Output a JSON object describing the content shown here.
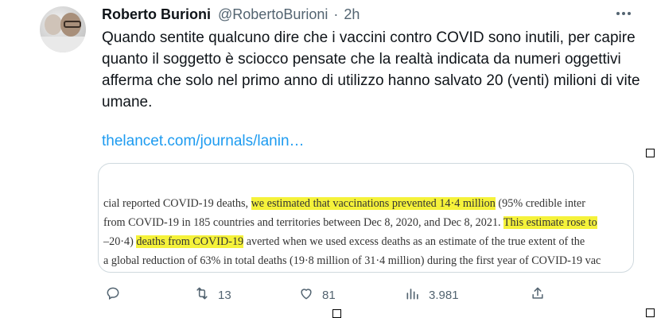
{
  "tweet": {
    "author_name": "Roberto Burioni",
    "handle": "@RobertoBurioni",
    "separator": "·",
    "time": "2h",
    "text": "Quando sentite qualcuno dire che i vaccini contro COVID sono inutili, per capire quanto il soggetto è sciocco pensate che la realtà indicata da numeri oggettivi afferma che solo nel primo anno di utilizzo hanno salvato 20 (venti) milioni di vite umane.",
    "link": "thelancet.com/journals/lanin…"
  },
  "media": {
    "lines": [
      [
        {
          "t": "cial reported COVID-19 deaths, ",
          "h": false
        },
        {
          "t": "we estimated that vaccinations prevented 14·4 million",
          "h": true
        },
        {
          "t": " (95% credible inter",
          "h": false
        }
      ],
      [
        {
          "t": "from COVID-19 in 185 countries and territories between Dec 8, 2020, and Dec 8, 2021. ",
          "h": false
        },
        {
          "t": "This estimate rose to",
          "h": true
        }
      ],
      [
        {
          "t": "–20·4) ",
          "h": false
        },
        {
          "t": "deaths from COVID-19",
          "h": true
        },
        {
          "t": " averted when we used excess deaths as an estimate of the true extent of the",
          "h": false
        }
      ],
      [
        {
          "t": "a global reduction of 63% in total deaths (19·8 million of 31·4 million) during the first year of COVID-19 vac",
          "h": false
        }
      ]
    ]
  },
  "actions": {
    "replies": "",
    "retweets": "13",
    "likes": "81",
    "views": "3.981"
  },
  "icons": {
    "more": "more-dots-icon",
    "reply": "reply-icon",
    "retweet": "retweet-icon",
    "like": "heart-icon",
    "views": "views-chart-icon",
    "share": "share-icon"
  },
  "colors": {
    "link": "#1d9bf0",
    "secondary": "#536471",
    "highlight": "#f5f23a"
  }
}
